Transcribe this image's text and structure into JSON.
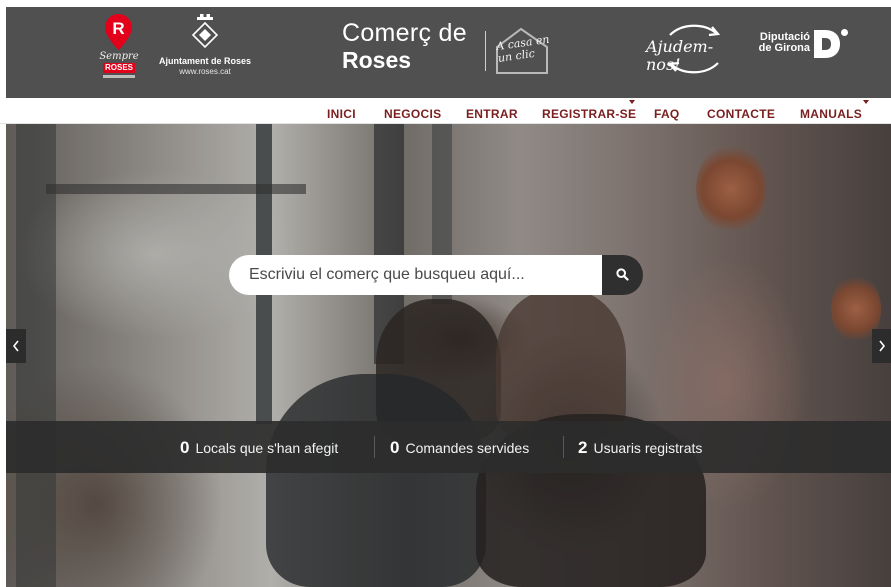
{
  "header": {
    "sempre_roses": {
      "script": "Sempre",
      "roses": "ROSES"
    },
    "ajuntament": {
      "name": "Ajuntament de Roses",
      "url": "www.roses.cat"
    },
    "comerc": {
      "line1": "Comerç de",
      "line2": "Roses",
      "tagline": "A casa en un clic"
    },
    "ajudem": "Ajudem-nos!",
    "diputacio": {
      "line1": "Diputació",
      "line2": "de Girona"
    }
  },
  "nav": {
    "items": [
      {
        "label": "INICI"
      },
      {
        "label": "NEGOCIS"
      },
      {
        "label": "ENTRAR"
      },
      {
        "label": "REGISTRAR-SE"
      },
      {
        "label": "FAQ"
      },
      {
        "label": "CONTACTE"
      },
      {
        "label": "MANUALS"
      }
    ]
  },
  "search": {
    "placeholder": "Escriviu el comerç que busqueu aquí..."
  },
  "stats": [
    {
      "value": "0",
      "label": "Locals que s'han afegit"
    },
    {
      "value": "0",
      "label": "Comandes servides"
    },
    {
      "value": "2",
      "label": "Usuaris registrats"
    }
  ],
  "colors": {
    "header_bg": "#505050",
    "nav_text": "#7a1e1e",
    "brand_red": "#e2001a",
    "stats_bg": "#2c2c2c",
    "search_button": "#2f2f2f"
  }
}
